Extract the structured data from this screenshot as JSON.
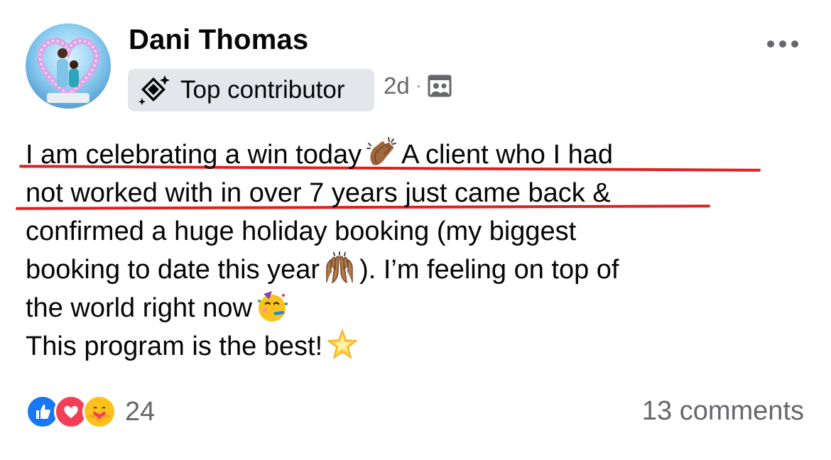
{
  "author": {
    "name": "Dani Thomas"
  },
  "badge": {
    "label": "Top contributor",
    "icon": "top-contributor-diamond-icon"
  },
  "meta": {
    "time": "2d",
    "separator": "·",
    "audience_icon": "group-audience-icon"
  },
  "post": {
    "line1a": "I am celebrating a win today",
    "line1b": "A client who I had",
    "line2": "not worked with in over 7 years just came back &",
    "line3": "confirmed a huge holiday booking (my biggest",
    "line4a": "booking to date this year",
    "line4b": "). I’m feeling on top of",
    "line5": "the world right now",
    "line6": "This program is the best!",
    "emojis": [
      "clapping-hands-emoji",
      "raising-hands-emoji",
      "partying-face-emoji",
      "glowing-star-emoji"
    ]
  },
  "reactions": {
    "types": [
      "like-reaction-icon",
      "love-reaction-icon",
      "care-reaction-icon"
    ],
    "count": "24"
  },
  "comments": {
    "label": "13 comments"
  },
  "colors": {
    "text": "#050505",
    "secondary": "#65676b",
    "badge_bg": "#e4e6eb",
    "underline": "#e02020",
    "like": "#1877f2",
    "love": "#f33e58"
  }
}
